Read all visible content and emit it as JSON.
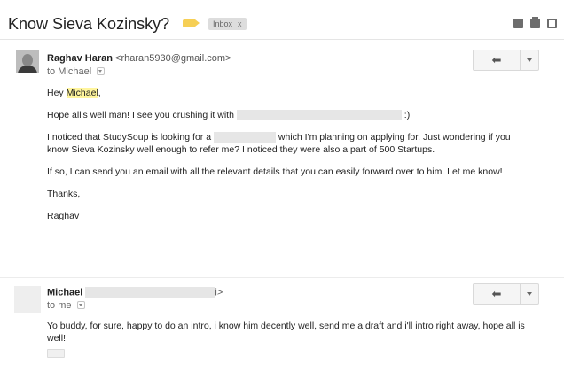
{
  "thread": {
    "subject": "Know Sieva Kozinsky?",
    "label_color": "#f6cf55",
    "inbox_label": "Inbox",
    "inbox_remove": "x",
    "toolbar_icons": [
      "archive-icon",
      "print-icon",
      "new-window-icon"
    ]
  },
  "messages": [
    {
      "sender_name": "Raghav Haran",
      "sender_email": "<rharan5930@gmail.com>",
      "to_prefix": "to",
      "to_name": "Michael",
      "reply_icon": "reply-arrow-icon",
      "body": {
        "greeting_prefix": "Hey ",
        "greeting_name": "Michael",
        "greeting_suffix": ",",
        "p1_start": "Hope all's well man! I see you crushing it with",
        "p1_end": ":)",
        "p2_start": "I noticed that StudySoup is looking for a",
        "p2_mid": "which I'm planning on applying for. Just wondering if you",
        "p2_line2": "know Sieva Kozinsky well enough to refer me? I noticed they were also a part of 500 Startups.",
        "p3": "If so, I can send you an email with all the relevant details that you can easily forward over to him. Let me know!",
        "signoff": "Thanks,",
        "signature": "Raghav"
      }
    },
    {
      "sender_name": "Michael",
      "sender_email_tail": "i>",
      "to_prefix": "to",
      "to_name": "me",
      "reply_icon": "reply-arrow-icon",
      "body": {
        "line1": "Yo buddy, for sure, happy to do an intro, i know him decently well, send me a draft and i'll intro right away, hope all is",
        "line2": "well!",
        "trimmed": "···"
      }
    }
  ],
  "colors": {
    "highlight": "#fff59d",
    "redaction": "#e6e6e6"
  }
}
